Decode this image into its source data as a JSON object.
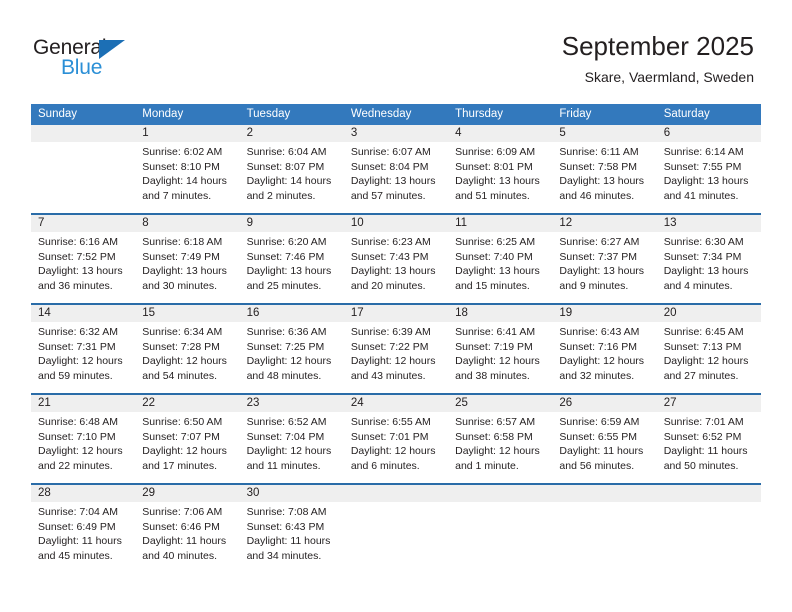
{
  "brand": {
    "name_top": "General",
    "name_bottom": "Blue",
    "accent_color": "#2b8fd6",
    "triangle_color": "#1c6fb5"
  },
  "header": {
    "title": "September 2025",
    "subtitle": "Skare, Vaermland, Sweden"
  },
  "calendar": {
    "header_bg": "#3379bd",
    "date_band_bg": "#efefef",
    "row_rule_color": "#2a6ca8",
    "weekdays": [
      "Sunday",
      "Monday",
      "Tuesday",
      "Wednesday",
      "Thursday",
      "Friday",
      "Saturday"
    ],
    "weeks": [
      {
        "days": [
          {
            "date": "",
            "sunrise": "",
            "sunset": "",
            "daylight": ""
          },
          {
            "date": "1",
            "sunrise": "Sunrise: 6:02 AM",
            "sunset": "Sunset: 8:10 PM",
            "daylight": "Daylight: 14 hours and 7 minutes."
          },
          {
            "date": "2",
            "sunrise": "Sunrise: 6:04 AM",
            "sunset": "Sunset: 8:07 PM",
            "daylight": "Daylight: 14 hours and 2 minutes."
          },
          {
            "date": "3",
            "sunrise": "Sunrise: 6:07 AM",
            "sunset": "Sunset: 8:04 PM",
            "daylight": "Daylight: 13 hours and 57 minutes."
          },
          {
            "date": "4",
            "sunrise": "Sunrise: 6:09 AM",
            "sunset": "Sunset: 8:01 PM",
            "daylight": "Daylight: 13 hours and 51 minutes."
          },
          {
            "date": "5",
            "sunrise": "Sunrise: 6:11 AM",
            "sunset": "Sunset: 7:58 PM",
            "daylight": "Daylight: 13 hours and 46 minutes."
          },
          {
            "date": "6",
            "sunrise": "Sunrise: 6:14 AM",
            "sunset": "Sunset: 7:55 PM",
            "daylight": "Daylight: 13 hours and 41 minutes."
          }
        ]
      },
      {
        "days": [
          {
            "date": "7",
            "sunrise": "Sunrise: 6:16 AM",
            "sunset": "Sunset: 7:52 PM",
            "daylight": "Daylight: 13 hours and 36 minutes."
          },
          {
            "date": "8",
            "sunrise": "Sunrise: 6:18 AM",
            "sunset": "Sunset: 7:49 PM",
            "daylight": "Daylight: 13 hours and 30 minutes."
          },
          {
            "date": "9",
            "sunrise": "Sunrise: 6:20 AM",
            "sunset": "Sunset: 7:46 PM",
            "daylight": "Daylight: 13 hours and 25 minutes."
          },
          {
            "date": "10",
            "sunrise": "Sunrise: 6:23 AM",
            "sunset": "Sunset: 7:43 PM",
            "daylight": "Daylight: 13 hours and 20 minutes."
          },
          {
            "date": "11",
            "sunrise": "Sunrise: 6:25 AM",
            "sunset": "Sunset: 7:40 PM",
            "daylight": "Daylight: 13 hours and 15 minutes."
          },
          {
            "date": "12",
            "sunrise": "Sunrise: 6:27 AM",
            "sunset": "Sunset: 7:37 PM",
            "daylight": "Daylight: 13 hours and 9 minutes."
          },
          {
            "date": "13",
            "sunrise": "Sunrise: 6:30 AM",
            "sunset": "Sunset: 7:34 PM",
            "daylight": "Daylight: 13 hours and 4 minutes."
          }
        ]
      },
      {
        "days": [
          {
            "date": "14",
            "sunrise": "Sunrise: 6:32 AM",
            "sunset": "Sunset: 7:31 PM",
            "daylight": "Daylight: 12 hours and 59 minutes."
          },
          {
            "date": "15",
            "sunrise": "Sunrise: 6:34 AM",
            "sunset": "Sunset: 7:28 PM",
            "daylight": "Daylight: 12 hours and 54 minutes."
          },
          {
            "date": "16",
            "sunrise": "Sunrise: 6:36 AM",
            "sunset": "Sunset: 7:25 PM",
            "daylight": "Daylight: 12 hours and 48 minutes."
          },
          {
            "date": "17",
            "sunrise": "Sunrise: 6:39 AM",
            "sunset": "Sunset: 7:22 PM",
            "daylight": "Daylight: 12 hours and 43 minutes."
          },
          {
            "date": "18",
            "sunrise": "Sunrise: 6:41 AM",
            "sunset": "Sunset: 7:19 PM",
            "daylight": "Daylight: 12 hours and 38 minutes."
          },
          {
            "date": "19",
            "sunrise": "Sunrise: 6:43 AM",
            "sunset": "Sunset: 7:16 PM",
            "daylight": "Daylight: 12 hours and 32 minutes."
          },
          {
            "date": "20",
            "sunrise": "Sunrise: 6:45 AM",
            "sunset": "Sunset: 7:13 PM",
            "daylight": "Daylight: 12 hours and 27 minutes."
          }
        ]
      },
      {
        "days": [
          {
            "date": "21",
            "sunrise": "Sunrise: 6:48 AM",
            "sunset": "Sunset: 7:10 PM",
            "daylight": "Daylight: 12 hours and 22 minutes."
          },
          {
            "date": "22",
            "sunrise": "Sunrise: 6:50 AM",
            "sunset": "Sunset: 7:07 PM",
            "daylight": "Daylight: 12 hours and 17 minutes."
          },
          {
            "date": "23",
            "sunrise": "Sunrise: 6:52 AM",
            "sunset": "Sunset: 7:04 PM",
            "daylight": "Daylight: 12 hours and 11 minutes."
          },
          {
            "date": "24",
            "sunrise": "Sunrise: 6:55 AM",
            "sunset": "Sunset: 7:01 PM",
            "daylight": "Daylight: 12 hours and 6 minutes."
          },
          {
            "date": "25",
            "sunrise": "Sunrise: 6:57 AM",
            "sunset": "Sunset: 6:58 PM",
            "daylight": "Daylight: 12 hours and 1 minute."
          },
          {
            "date": "26",
            "sunrise": "Sunrise: 6:59 AM",
            "sunset": "Sunset: 6:55 PM",
            "daylight": "Daylight: 11 hours and 56 minutes."
          },
          {
            "date": "27",
            "sunrise": "Sunrise: 7:01 AM",
            "sunset": "Sunset: 6:52 PM",
            "daylight": "Daylight: 11 hours and 50 minutes."
          }
        ]
      },
      {
        "days": [
          {
            "date": "28",
            "sunrise": "Sunrise: 7:04 AM",
            "sunset": "Sunset: 6:49 PM",
            "daylight": "Daylight: 11 hours and 45 minutes."
          },
          {
            "date": "29",
            "sunrise": "Sunrise: 7:06 AM",
            "sunset": "Sunset: 6:46 PM",
            "daylight": "Daylight: 11 hours and 40 minutes."
          },
          {
            "date": "30",
            "sunrise": "Sunrise: 7:08 AM",
            "sunset": "Sunset: 6:43 PM",
            "daylight": "Daylight: 11 hours and 34 minutes."
          },
          {
            "date": "",
            "sunrise": "",
            "sunset": "",
            "daylight": ""
          },
          {
            "date": "",
            "sunrise": "",
            "sunset": "",
            "daylight": ""
          },
          {
            "date": "",
            "sunrise": "",
            "sunset": "",
            "daylight": ""
          },
          {
            "date": "",
            "sunrise": "",
            "sunset": "",
            "daylight": ""
          }
        ]
      }
    ]
  }
}
